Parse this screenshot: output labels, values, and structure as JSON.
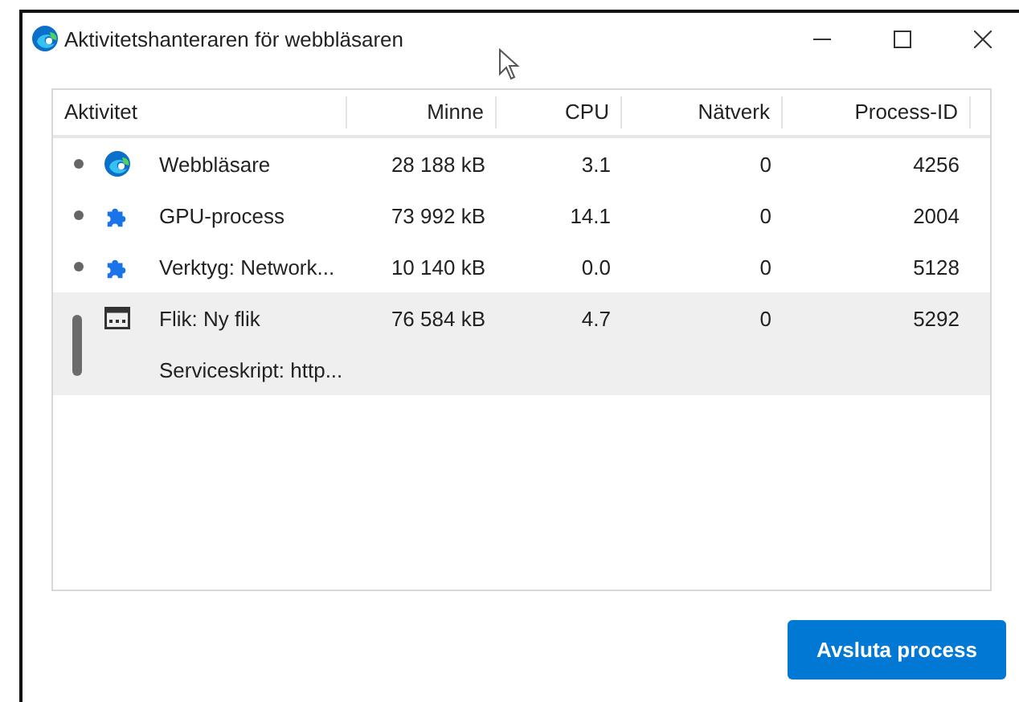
{
  "window": {
    "title": "Aktivitetshanteraren för webbläsaren"
  },
  "table": {
    "columns": [
      "Aktivitet",
      "Minne",
      "CPU",
      "Nätverk",
      "Process-ID"
    ],
    "rows": [
      {
        "kind": "browser",
        "name": "Webbläsare",
        "memory": "28 188 kB",
        "cpu": "3.1",
        "network": "0",
        "pid": "4256",
        "selected": false
      },
      {
        "kind": "extension",
        "name": "GPU-process",
        "memory": "73 992 kB",
        "cpu": "14.1",
        "network": "0",
        "pid": "2004",
        "selected": false
      },
      {
        "kind": "extension",
        "name": "Verktyg: Network...",
        "memory": "10 140 kB",
        "cpu": "0.0",
        "network": "0",
        "pid": "5128",
        "selected": false
      },
      {
        "kind": "tab",
        "name": "Flik: Ny flik",
        "memory": "76 584 kB",
        "cpu": "4.7",
        "network": "0",
        "pid": "5292",
        "selected": true,
        "children": [
          {
            "name": "Serviceskript: http..."
          }
        ]
      }
    ]
  },
  "buttons": [
    {
      "label": "Avsluta process"
    }
  ]
}
